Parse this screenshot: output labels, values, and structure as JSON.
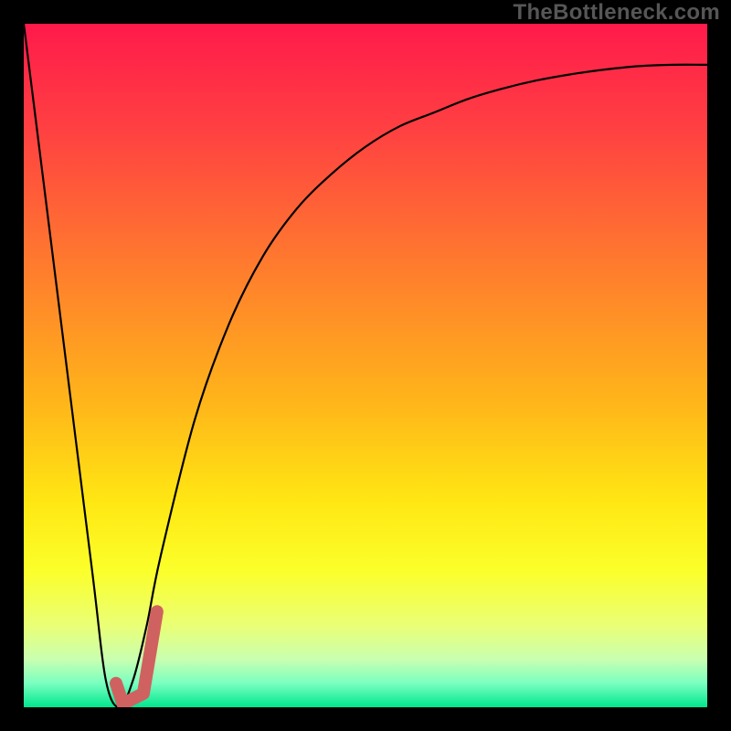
{
  "watermark": "TheBottleneck.com",
  "colors": {
    "frame": "#000000",
    "curve": "#000000",
    "accent_stroke": "#cf6260",
    "gradient_stops": [
      {
        "offset": 0.0,
        "color": "#ff1a4b"
      },
      {
        "offset": 0.15,
        "color": "#ff3f42"
      },
      {
        "offset": 0.35,
        "color": "#ff7a2e"
      },
      {
        "offset": 0.55,
        "color": "#ffb41a"
      },
      {
        "offset": 0.7,
        "color": "#ffe713"
      },
      {
        "offset": 0.8,
        "color": "#fbff2a"
      },
      {
        "offset": 0.88,
        "color": "#eaff75"
      },
      {
        "offset": 0.93,
        "color": "#c9ffb0"
      },
      {
        "offset": 0.965,
        "color": "#7affc0"
      },
      {
        "offset": 1.0,
        "color": "#00e68e"
      }
    ]
  },
  "chart_data": {
    "type": "line",
    "title": "",
    "xlabel": "",
    "ylabel": "",
    "xlim": [
      0,
      100
    ],
    "ylim": [
      0,
      100
    ],
    "series": [
      {
        "name": "bottleneck-curve",
        "x": [
          0,
          5,
          10,
          12,
          14,
          16,
          18,
          20,
          25,
          30,
          35,
          40,
          45,
          50,
          55,
          60,
          65,
          70,
          75,
          80,
          85,
          90,
          95,
          100
        ],
        "values": [
          100,
          60,
          20,
          4,
          0,
          4,
          12,
          22,
          42,
          56,
          66,
          73,
          78,
          82,
          85,
          87,
          89,
          90.5,
          91.7,
          92.6,
          93.3,
          93.8,
          94,
          94
        ]
      },
      {
        "name": "accent-hook",
        "x": [
          13.5,
          14.5,
          17.5,
          19.5
        ],
        "values": [
          3.5,
          0.5,
          2.0,
          14.0
        ]
      }
    ]
  }
}
